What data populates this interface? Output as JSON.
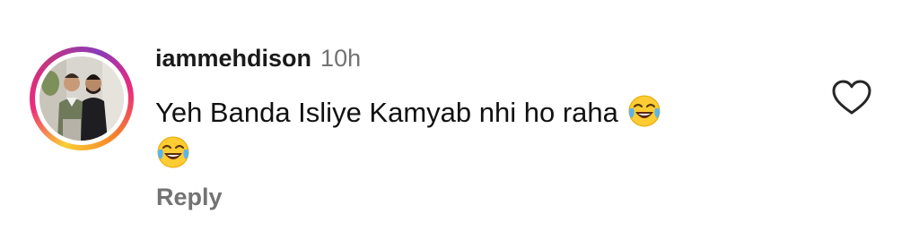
{
  "comment": {
    "username": "iammehdison",
    "time": "10h",
    "text": "Yeh Banda Isliye Kamyab nhi ho raha",
    "emojis": [
      "face-with-tears-of-joy",
      "face-with-tears-of-joy"
    ],
    "reply_label": "Reply",
    "like_icon": "heart-outline-icon",
    "liked": false
  },
  "colors": {
    "username": "#1a1a1a",
    "meta": "#737373",
    "ring": [
      "#f9ce34",
      "#ee2a7b",
      "#8a3ab9"
    ]
  }
}
